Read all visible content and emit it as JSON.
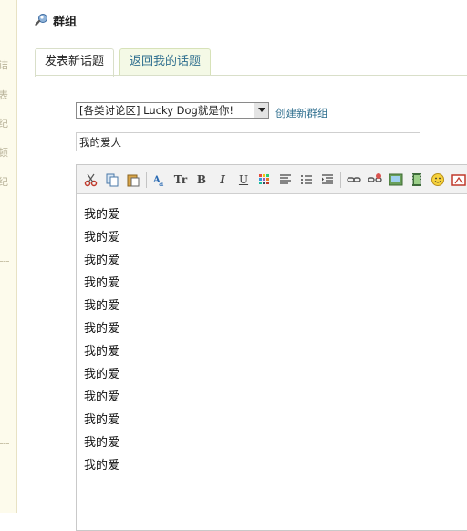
{
  "header": {
    "title": "群组",
    "icon": "group-icon"
  },
  "tabs": [
    {
      "label": "发表新话题",
      "active": true
    },
    {
      "label": "返回我的话题",
      "active": false
    }
  ],
  "form": {
    "category_select": "[各类讨论区] Lucky Dog就是你!",
    "create_group_link": "创建新群组",
    "title_value": "我的爱人"
  },
  "editor": {
    "toolbar": [
      "cut-icon",
      "copy-icon",
      "paste-icon",
      "font-color-icon",
      "font-size-icon",
      "bold-icon",
      "italic-icon",
      "underline-icon",
      "color-grid-icon",
      "align-icon",
      "list-icon",
      "indent-icon",
      "link-icon",
      "unlink-icon",
      "image-icon",
      "video-icon",
      "smiley-icon",
      "flash-icon"
    ],
    "lines": [
      "我的爱",
      "我的爱",
      "我的爱",
      "我的爱",
      "我的爱",
      "我的爱",
      "我的爱",
      "我的爱",
      "我的爱",
      "我的爱",
      "我的爱",
      "我的爱"
    ]
  },
  "left_strip_glyphs": [
    "诘",
    "表",
    "纪",
    "顿",
    "纪"
  ]
}
